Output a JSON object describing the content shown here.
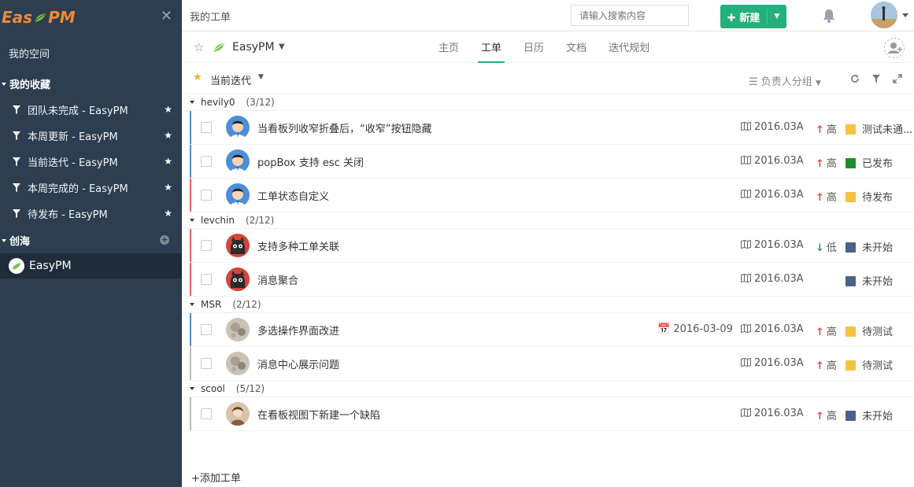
{
  "sidebar": {
    "logo_text_a": "Eas",
    "logo_text_b": "PM",
    "my_space": "我的空间",
    "favorites_header": "我的收藏",
    "favorites": [
      {
        "label": "团队未完成 - EasyPM"
      },
      {
        "label": "本周更新 - EasyPM"
      },
      {
        "label": "当前迭代 - EasyPM"
      },
      {
        "label": "本周完成的 - EasyPM"
      },
      {
        "label": "待发布 - EasyPM"
      }
    ],
    "team_header": "创海",
    "project": "EasyPM"
  },
  "topbar": {
    "title": "我的工单",
    "search_placeholder": "请输入搜索内容",
    "new_label": "新建"
  },
  "project": {
    "name": "EasyPM",
    "tabs": [
      "主页",
      "工单",
      "日历",
      "文档",
      "迭代规划"
    ],
    "active_tab": 1
  },
  "filter": {
    "iteration": "当前迭代",
    "group_by": "负责人分组"
  },
  "colors": {
    "accent": "#22b07d",
    "sidebar": "#2c3e50",
    "yellow": "#f5c242",
    "green": "#1e8c2e",
    "slate": "#4a6285"
  },
  "groups": [
    {
      "name": "hevily0",
      "count": "(3/12)",
      "items": [
        {
          "title": "当看板列收窄折叠后，“收窄”按钮隐藏",
          "due": "",
          "version": "2016.03A",
          "priority": "高",
          "dir": "up",
          "status": "测试未通...",
          "status_color": "#f5c242",
          "bar": "#4a90c2",
          "avatar": "boy"
        },
        {
          "title": "popBox 支持 esc 关闭",
          "due": "",
          "version": "2016.03A",
          "priority": "高",
          "dir": "up",
          "status": "已发布",
          "status_color": "#1e8c2e",
          "bar": "#4a90c2",
          "avatar": "boy"
        },
        {
          "title": "工单状态自定义",
          "due": "",
          "version": "2016.03A",
          "priority": "高",
          "dir": "up",
          "status": "待发布",
          "status_color": "#f5c242",
          "bar": "#e06666",
          "avatar": "boy"
        }
      ]
    },
    {
      "name": "levchin",
      "count": "(2/12)",
      "items": [
        {
          "title": "支持多种工单关联",
          "due": "",
          "version": "2016.03A",
          "priority": "低",
          "dir": "down",
          "status": "未开始",
          "status_color": "#4a6285",
          "bar": "#e06666",
          "avatar": "cat"
        },
        {
          "title": "消息聚合",
          "due": "",
          "version": "2016.03A",
          "priority": "",
          "dir": "",
          "status": "未开始",
          "status_color": "#4a6285",
          "bar": "#e06666",
          "avatar": "cat"
        }
      ]
    },
    {
      "name": "MSR",
      "count": "(2/12)",
      "items": [
        {
          "title": "多选操作界面改进",
          "due": "2016-03-09",
          "version": "2016.03A",
          "priority": "高",
          "dir": "up",
          "status": "待测试",
          "status_color": "#f5c242",
          "bar": "#4a90c2",
          "avatar": "gray"
        },
        {
          "title": "消息中心展示问题",
          "due": "",
          "version": "2016.03A",
          "priority": "高",
          "dir": "up",
          "status": "待测试",
          "status_color": "#f5c242",
          "bar": "#bbbbbb",
          "avatar": "gray"
        }
      ]
    },
    {
      "name": "scool",
      "count": "(5/12)",
      "items": [
        {
          "title": "在看板视图下新建一个缺陷",
          "due": "",
          "version": "2016.03A",
          "priority": "高",
          "dir": "up",
          "status": "未开始",
          "status_color": "#4a6285",
          "bar": "#bbbbbb",
          "avatar": "girl"
        }
      ]
    }
  ],
  "add_issue": "添加工单"
}
